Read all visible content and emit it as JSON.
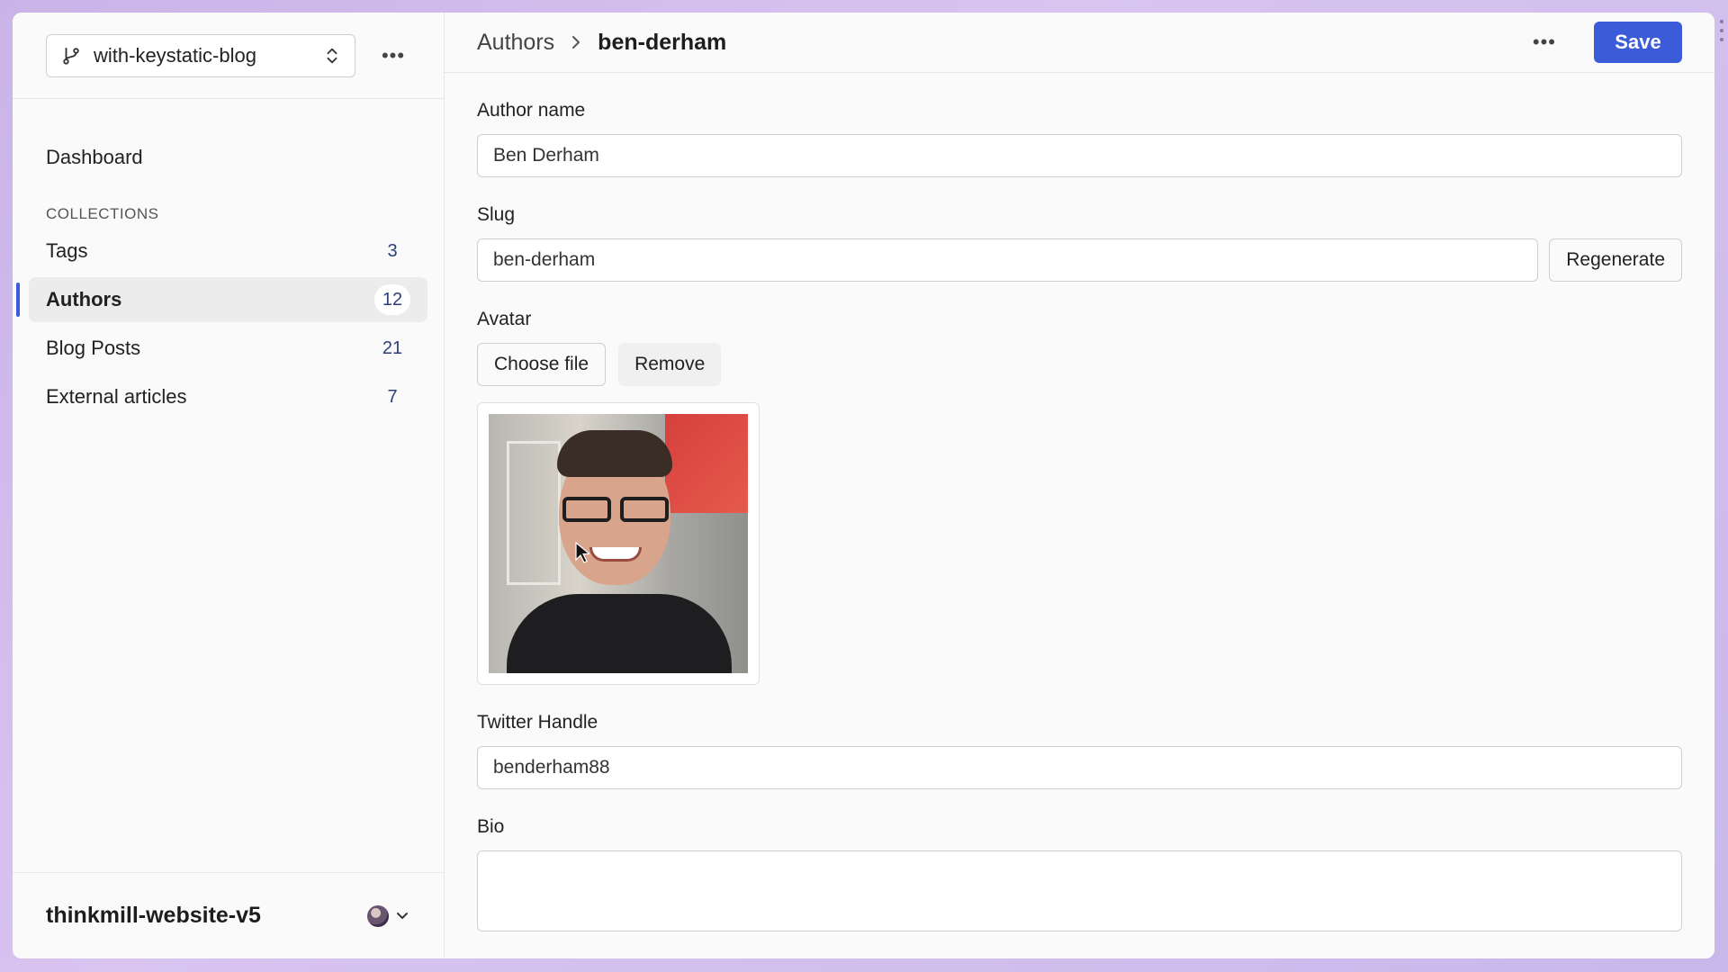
{
  "sidebar": {
    "branch": "with-keystatic-blog",
    "dashboard_label": "Dashboard",
    "collections_heading": "COLLECTIONS",
    "items": [
      {
        "label": "Tags",
        "count": "3"
      },
      {
        "label": "Authors",
        "count": "12"
      },
      {
        "label": "Blog Posts",
        "count": "21"
      },
      {
        "label": "External articles",
        "count": "7"
      }
    ],
    "project_name": "thinkmill-website-v5"
  },
  "header": {
    "breadcrumb_parent": "Authors",
    "breadcrumb_current": "ben-derham",
    "save_label": "Save"
  },
  "form": {
    "author_name_label": "Author name",
    "author_name_value": "Ben Derham",
    "slug_label": "Slug",
    "slug_value": "ben-derham",
    "regenerate_label": "Regenerate",
    "avatar_label": "Avatar",
    "choose_file_label": "Choose file",
    "remove_label": "Remove",
    "twitter_label": "Twitter Handle",
    "twitter_value": "benderham88",
    "bio_label": "Bio"
  },
  "colors": {
    "accent": "#3b5bd9",
    "background": "#fafafa"
  },
  "icons": {
    "branch": "git-branch-icon",
    "selector": "chevron-up-down-icon",
    "more": "more-horizontal-icon",
    "breadcrumb_separator": "chevron-right-icon",
    "user_caret": "chevron-down-icon"
  }
}
